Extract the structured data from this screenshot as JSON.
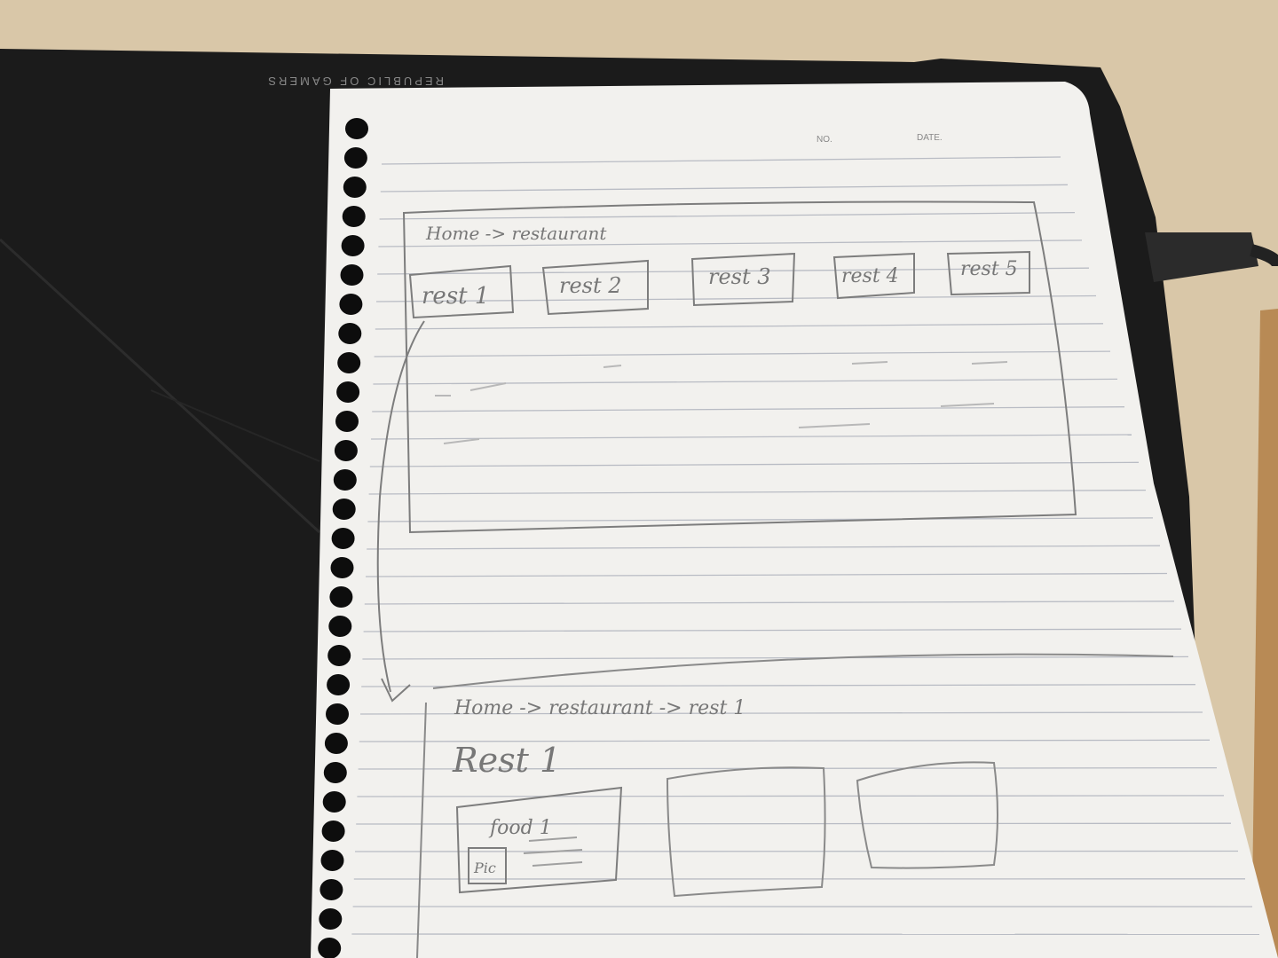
{
  "laptop": {
    "brand_text": "REPUBLIC OF GAMERS"
  },
  "paper": {
    "header": {
      "no_label": "NO.",
      "date_label": "DATE."
    }
  },
  "sketch1": {
    "breadcrumb": "Home -> restaurant",
    "restaurants": [
      "rest 1",
      "rest 2",
      "rest 3",
      "rest 4",
      "rest 5"
    ]
  },
  "sketch2": {
    "breadcrumb": "Home -> restaurant -> rest 1",
    "title": "Rest 1",
    "card": {
      "title": "food 1",
      "pic_label": "Pic"
    }
  },
  "colors": {
    "desk": "#d9c7a8",
    "laptop": "#1b1b1b",
    "paper": "#f2f1ee",
    "ruling": "#b9bcc4",
    "pencil": "#777777",
    "hole": "#0d0d0d"
  }
}
